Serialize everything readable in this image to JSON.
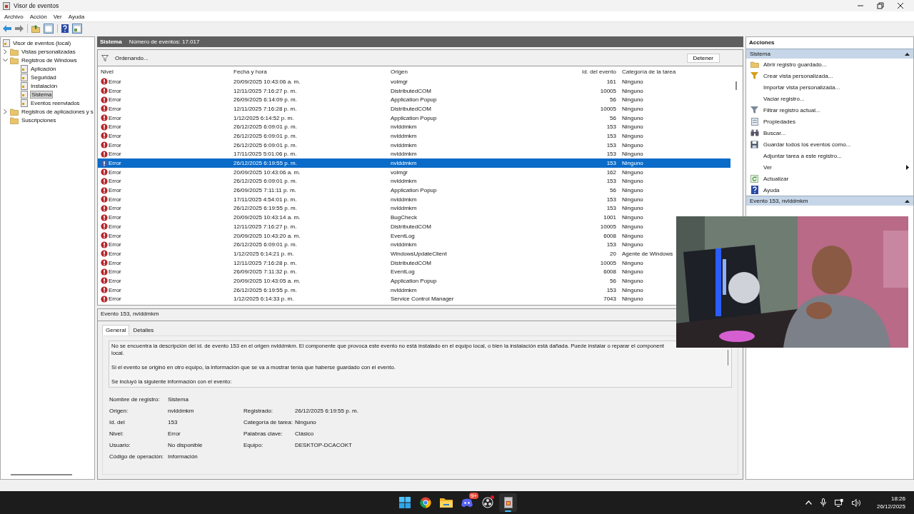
{
  "window": {
    "title": "Visor de eventos"
  },
  "menu": [
    "Archivo",
    "Acción",
    "Ver",
    "Ayuda"
  ],
  "tree": [
    {
      "label": "Visor de eventos (local)",
      "selected": false
    },
    {
      "label": "Vistas personalizadas",
      "selected": false,
      "expanded": false
    },
    {
      "label": "Registros de Windows",
      "selected": false,
      "expanded": true,
      "children": [
        {
          "label": "Aplicación",
          "selected": false
        },
        {
          "label": "Seguridad",
          "selected": false
        },
        {
          "label": "Instalación",
          "selected": false
        },
        {
          "label": "Sistema",
          "selected": true
        },
        {
          "label": "Eventos reenviados",
          "selected": false
        }
      ]
    },
    {
      "label": "Registros de aplicaciones y s",
      "selected": false,
      "expanded": false
    },
    {
      "label": "Suscripciones",
      "selected": false
    }
  ],
  "log_header": {
    "name": "Sistema",
    "count": "Número de eventos: 17.017"
  },
  "filter_bar": {
    "status": "Ordenando...",
    "button": "Detener"
  },
  "table": {
    "columns": [
      "Nivel",
      "Fecha y hora",
      "Origen",
      "Id. del evento",
      "Categoría de la tarea"
    ],
    "rows": [
      {
        "level": "Error",
        "date": "20/09/2025 10:43:06 a. m.",
        "source": "volmgr",
        "id": "161",
        "category": "Ninguno",
        "selected": false
      },
      {
        "level": "Error",
        "date": "12/11/2025 7:16:27 p. m.",
        "source": "DistributedCOM",
        "id": "10005",
        "category": "Ninguno",
        "selected": false
      },
      {
        "level": "Error",
        "date": "26/09/2025 6:14:09 p. m.",
        "source": "Application Popup",
        "id": "56",
        "category": "Ninguno",
        "selected": false
      },
      {
        "level": "Error",
        "date": "12/11/2025 7:16:28 p. m.",
        "source": "DistributedCOM",
        "id": "10005",
        "category": "Ninguno",
        "selected": false
      },
      {
        "level": "Error",
        "date": "1/12/2025 6:14:52 p. m.",
        "source": "Application Popup",
        "id": "56",
        "category": "Ninguno",
        "selected": false
      },
      {
        "level": "Error",
        "date": "26/12/2025 6:09:01 p. m.",
        "source": "nvlddmkm",
        "id": "153",
        "category": "Ninguno",
        "selected": false
      },
      {
        "level": "Error",
        "date": "26/12/2025 6:09:01 p. m.",
        "source": "nvlddmkm",
        "id": "153",
        "category": "Ninguno",
        "selected": false
      },
      {
        "level": "Error",
        "date": "26/12/2025 6:09:01 p. m.",
        "source": "nvlddmkm",
        "id": "153",
        "category": "Ninguno",
        "selected": false
      },
      {
        "level": "Error",
        "date": "17/11/2025 5:01:06 p. m.",
        "source": "nvlddmkm",
        "id": "153",
        "category": "Ninguno",
        "selected": false
      },
      {
        "level": "Error",
        "date": "26/12/2025 6:19:55 p. m.",
        "source": "nvlddmkm",
        "id": "153",
        "category": "Ninguno",
        "selected": true
      },
      {
        "level": "Error",
        "date": "20/09/2025 10:43:06 a. m.",
        "source": "volmgr",
        "id": "162",
        "category": "Ninguno",
        "selected": false
      },
      {
        "level": "Error",
        "date": "26/12/2025 6:09:01 p. m.",
        "source": "nvlddmkm",
        "id": "153",
        "category": "Ninguno",
        "selected": false
      },
      {
        "level": "Error",
        "date": "26/09/2025 7:11:11 p. m.",
        "source": "Application Popup",
        "id": "56",
        "category": "Ninguno",
        "selected": false
      },
      {
        "level": "Error",
        "date": "17/11/2025 4:54:01 p. m.",
        "source": "nvlddmkm",
        "id": "153",
        "category": "Ninguno",
        "selected": false
      },
      {
        "level": "Error",
        "date": "26/12/2025 6:19:55 p. m.",
        "source": "nvlddmkm",
        "id": "153",
        "category": "Ninguno",
        "selected": false
      },
      {
        "level": "Error",
        "date": "20/09/2025 10:43:14 a. m.",
        "source": "BugCheck",
        "id": "1001",
        "category": "Ninguno",
        "selected": false
      },
      {
        "level": "Error",
        "date": "12/11/2025 7:16:27 p. m.",
        "source": "DistributedCOM",
        "id": "10005",
        "category": "Ninguno",
        "selected": false
      },
      {
        "level": "Error",
        "date": "20/09/2025 10:43:20 a. m.",
        "source": "EventLog",
        "id": "6008",
        "category": "Ninguno",
        "selected": false
      },
      {
        "level": "Error",
        "date": "26/12/2025 6:09:01 p. m.",
        "source": "nvlddmkm",
        "id": "153",
        "category": "Ninguno",
        "selected": false
      },
      {
        "level": "Error",
        "date": "1/12/2025 6:14:21 p. m.",
        "source": "WindowsUpdateClient",
        "id": "20",
        "category": "Agente de Windows",
        "selected": false
      },
      {
        "level": "Error",
        "date": "12/11/2025 7:16:28 p. m.",
        "source": "DistributedCOM",
        "id": "10005",
        "category": "Ninguno",
        "selected": false
      },
      {
        "level": "Error",
        "date": "26/09/2025 7:11:32 p. m.",
        "source": "EventLog",
        "id": "6008",
        "category": "Ninguno",
        "selected": false
      },
      {
        "level": "Error",
        "date": "20/09/2025 10:43:05 a. m.",
        "source": "Application Popup",
        "id": "56",
        "category": "Ninguno",
        "selected": false
      },
      {
        "level": "Error",
        "date": "26/12/2025 6:19:55 p. m.",
        "source": "nvlddmkm",
        "id": "153",
        "category": "Ninguno",
        "selected": false
      },
      {
        "level": "Error",
        "date": "1/12/2025 6:14:33 p. m.",
        "source": "Service Control Manager",
        "id": "7043",
        "category": "Ninguno",
        "selected": false
      }
    ]
  },
  "detail": {
    "title": "Evento 153, nvlddmkm",
    "tabs": [
      {
        "label": "General",
        "selected": true
      },
      {
        "label": "Detalles",
        "selected": false
      }
    ],
    "description": [
      "No se encuentra la descripción del id. de evento 153 en el origen nvlddmkm. El componente que provoca este evento no está instalado en el equipo local, o bien la instalación está dañada. Puede instalar o reparar el component",
      "local.",
      "Si el evento se originó en otro equipo, la información que se va a mostrar tenía que haberse guardado con el evento.",
      "Se incluyó la siguiente información con el evento:"
    ],
    "fields": [
      {
        "left": {
          "label": "Nombre de registro:",
          "value": "Sistema"
        }
      },
      {
        "left": {
          "label": "Origen:",
          "value": "nvlddmkm"
        },
        "right": {
          "label": "Registrado:",
          "value": "26/12/2025 6:19:55 p. m."
        }
      },
      {
        "left": {
          "label": "Id. del",
          "value": "153"
        },
        "right": {
          "label": "Categoría de tarea:",
          "value": "Ninguno"
        }
      },
      {
        "left": {
          "label": "Nivel:",
          "value": "Error"
        },
        "right": {
          "label": "Palabras clave:",
          "value": "Clásico"
        }
      },
      {
        "left": {
          "label": "Usuario:",
          "value": "No disponible"
        },
        "right": {
          "label": "Equipo:",
          "value": "DESKTOP-DCACOKT"
        }
      },
      {
        "left": {
          "label": "Código de operación:",
          "value": "Información"
        }
      }
    ]
  },
  "actions": {
    "title": "Acciones",
    "sections": [
      {
        "title": "Sistema",
        "expanded": true,
        "items": [
          {
            "label": "Abrir registro guardado..."
          },
          {
            "label": "Crear vista personalizada..."
          },
          {
            "label": "Importar vista personalizada..."
          },
          {
            "label": "Vaciar registro..."
          },
          {
            "label": "Filtrar registro actual..."
          },
          {
            "label": "Propiedades"
          },
          {
            "label": "Buscar..."
          },
          {
            "label": "Guardar todos los eventos como..."
          },
          {
            "label": "Adjuntar tarea a este registro..."
          },
          {
            "label": "Ver",
            "submenu": true
          },
          {
            "label": "Actualizar"
          },
          {
            "label": "Ayuda"
          }
        ]
      },
      {
        "title": "Evento 153, nvlddmkm",
        "expanded": true
      }
    ]
  },
  "webcam": {
    "kind": "picture"
  },
  "taskbar": {
    "apps": [
      {
        "selected": false
      },
      {
        "selected": false
      },
      {
        "selected": false
      },
      {
        "selected": false,
        "badge": "9+"
      },
      {
        "selected": false
      },
      {
        "selected": true
      }
    ],
    "time": "18:26",
    "date": "26/12/2025"
  }
}
